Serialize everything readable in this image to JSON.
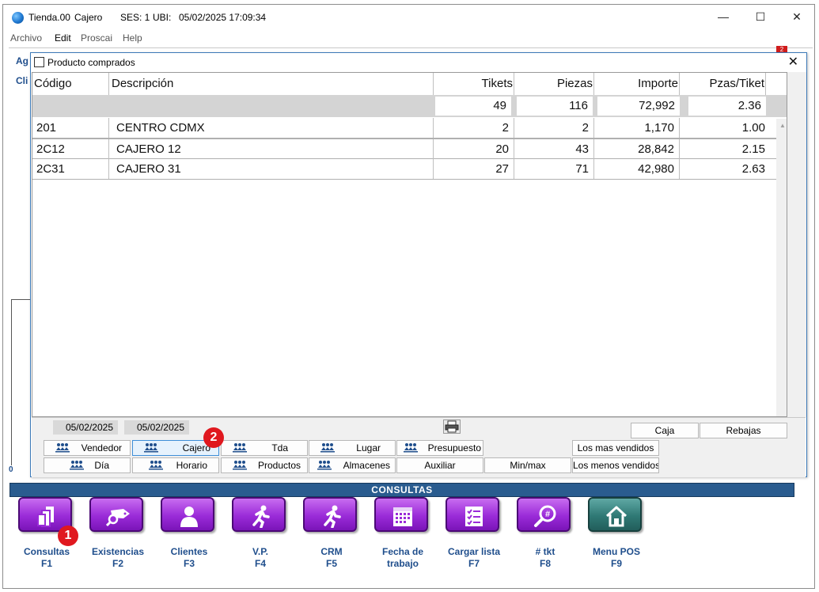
{
  "window": {
    "title_store": "Tienda.00",
    "title_user": "Cajero",
    "title_ses": "SES: 1",
    "title_ubi": "UBI:",
    "title_datetime": "05/02/2025 17:09:34",
    "minimize": "—",
    "maximize": "☐",
    "close": "✕"
  },
  "menu": [
    "Archivo",
    "Edit",
    "Proscai",
    "Help"
  ],
  "background": {
    "label1": "Ag",
    "label2": "Cli",
    "zero": "0",
    "badge": "2"
  },
  "dialog": {
    "title": "Producto comprados",
    "close": "✕",
    "columns": [
      "Código",
      "Descripción",
      "Tikets",
      "Piezas",
      "Importe",
      "Pzas/Tiket"
    ],
    "totals": {
      "tikets": "49",
      "piezas": "116",
      "importe": "72,992",
      "pzas_tiket": "2.36"
    },
    "rows": [
      {
        "codigo": "201",
        "descripcion": "CENTRO CDMX",
        "tikets": "2",
        "piezas": "2",
        "importe": "1,170",
        "pzas_tiket": "1.00"
      },
      {
        "codigo": "2C12",
        "descripcion": "CAJERO 12",
        "tikets": "20",
        "piezas": "43",
        "importe": "28,842",
        "pzas_tiket": "2.15"
      },
      {
        "codigo": "2C31",
        "descripcion": "CAJERO 31",
        "tikets": "27",
        "piezas": "71",
        "importe": "42,980",
        "pzas_tiket": "2.63"
      }
    ],
    "date_from": "05/02/2025",
    "date_to": "05/02/2025",
    "buttons": {
      "caja": "Caja",
      "rebajas": "Rebajas",
      "vendedor": "Vendedor",
      "cajero": "Cajero",
      "tda": "Tda",
      "lugar": "Lugar",
      "presupuesto": "Presupuesto",
      "mas_vendidos": "Los mas vendidos",
      "dia": "Día",
      "horario": "Horario",
      "productos": "Productos",
      "almacenes": "Almacenes",
      "auxiliar": "Auxiliar",
      "minmax": "Min/max",
      "menos_vendidos": "Los menos vendidos"
    },
    "callout_2": "2"
  },
  "consultas": {
    "header": "CONSULTAS",
    "callout_1": "1",
    "tiles": [
      {
        "line1": "Consultas",
        "line2": "F1",
        "icon": "stack-icon",
        "color": "#9a2bd8"
      },
      {
        "line1": "Existencias",
        "line2": "F2",
        "icon": "tag-search-icon",
        "color": "#9a2bd8"
      },
      {
        "line1": "Clientes",
        "line2": "F3",
        "icon": "person-icon",
        "color": "#9a2bd8"
      },
      {
        "line1": "V.P.",
        "line2": "F4",
        "icon": "runner-icon",
        "color": "#9a2bd8"
      },
      {
        "line1": "CRM",
        "line2": "F5",
        "icon": "runner-icon",
        "color": "#9a2bd8"
      },
      {
        "line1": "Fecha de",
        "line2": "trabajo",
        "icon": "calendar-icon",
        "color": "#9a2bd8"
      },
      {
        "line1": "Cargar lista",
        "line2": "F7",
        "icon": "checklist-icon",
        "color": "#9a2bd8"
      },
      {
        "line1": "# tkt",
        "line2": "F8",
        "icon": "hash-search-icon",
        "color": "#9a2bd8"
      },
      {
        "line1": "Menu POS",
        "line2": "F9",
        "icon": "home-icon",
        "color": "#2f7975"
      }
    ]
  }
}
